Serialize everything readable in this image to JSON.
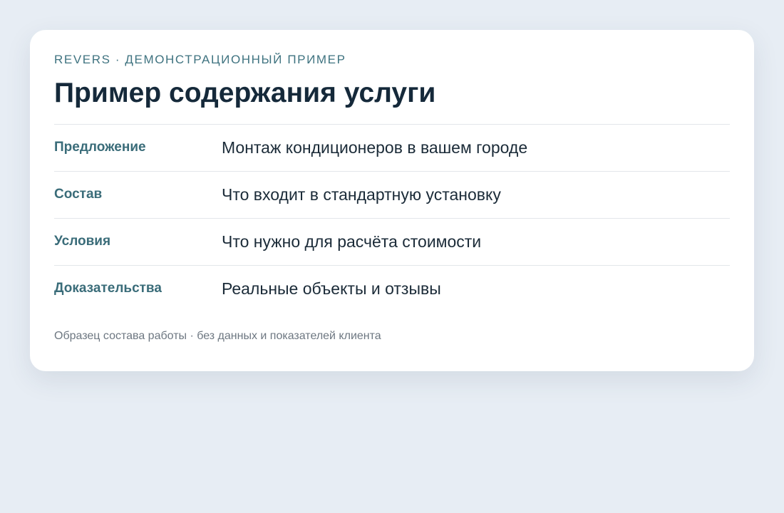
{
  "card": {
    "eyebrow": "REVERS · ДЕМОНСТРАЦИОННЫЙ ПРИМЕР",
    "title": "Пример содержания услуги",
    "rows": [
      {
        "label": "Предложение",
        "value": "Монтаж кондиционеров в вашем городе"
      },
      {
        "label": "Состав",
        "value": "Что входит в стандартную установку"
      },
      {
        "label": "Условия",
        "value": "Что нужно для расчёта стоимости"
      },
      {
        "label": "Доказательства",
        "value": "Реальные объекты и отзывы"
      }
    ],
    "footer": "Образец состава работы · без данных и показателей клиента"
  },
  "colors": {
    "background": "#e7edf4",
    "card": "#ffffff",
    "accent": "#3a6c79",
    "title": "#15293a"
  }
}
